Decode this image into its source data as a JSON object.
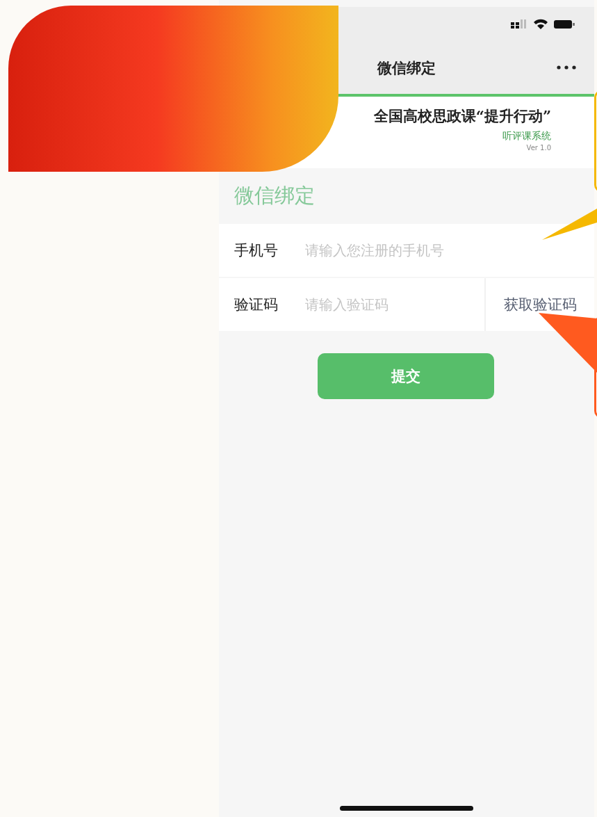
{
  "nav_bar": {
    "title": "微信绑定"
  },
  "banner": {
    "title": "全国高校思政课“提升行动”",
    "subtitle": "听评课系统",
    "version": "Ver 1.0"
  },
  "section_title": "微信绑定",
  "form": {
    "rows": [
      {
        "kind": "text",
        "label": "手机号",
        "placeholder": "请输入您注册的手机号"
      },
      {
        "kind": "code",
        "label": "验证码",
        "placeholder": "请输入验证码",
        "button": "获取验证码"
      }
    ]
  },
  "submit_button": "提交"
}
